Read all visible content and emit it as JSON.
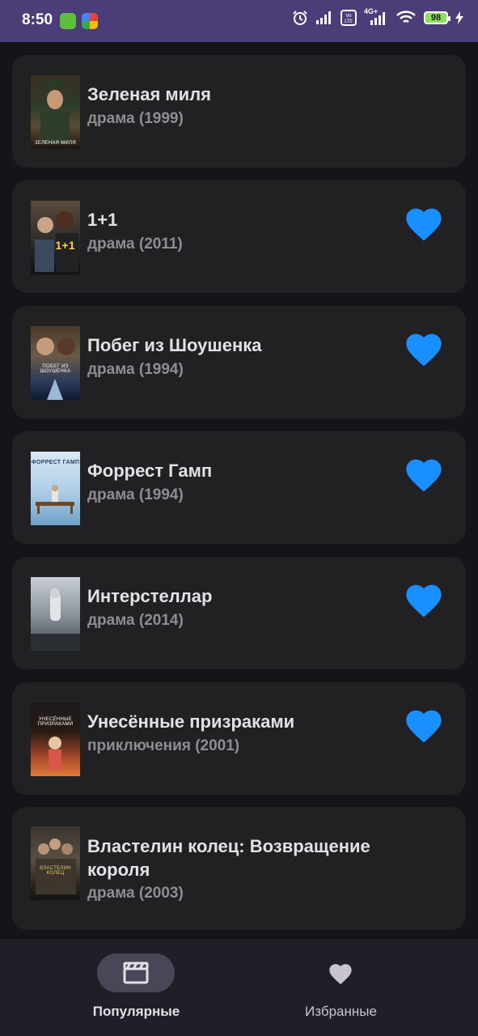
{
  "status_bar": {
    "time": "8:50",
    "battery": "98",
    "network": "4G+"
  },
  "movies": [
    {
      "title": "Зеленая миля",
      "subtitle": "драма (1999)",
      "favorite": false,
      "poster_caption": "ЗЕЛЕНАЯ МИЛЯ"
    },
    {
      "title": "1+1",
      "subtitle": "драма (2011)",
      "favorite": true,
      "poster_caption": "1+1"
    },
    {
      "title": "Побег из Шоушенка",
      "subtitle": "драма (1994)",
      "favorite": true,
      "poster_caption": "ПОБЕГ ИЗ ШОУШЕНКА"
    },
    {
      "title": "Форрест Гамп",
      "subtitle": "драма (1994)",
      "favorite": true,
      "poster_caption": "ФОРРЕСТ ГАМП"
    },
    {
      "title": "Интерстеллар",
      "subtitle": "драма (2014)",
      "favorite": true,
      "poster_caption": ""
    },
    {
      "title": "Унесённые призраками",
      "subtitle": "приключения (2001)",
      "favorite": true,
      "poster_caption": "УНЕСЁННЫЕ ПРИЗРАКАМИ"
    },
    {
      "title": "Властелин колец: Возвращение короля",
      "subtitle": "драма (2003)",
      "favorite": false,
      "poster_caption": "ВЛАСТЕЛИН КОЛЕЦ"
    }
  ],
  "bottom_nav": {
    "popular_label": "Популярные",
    "favorites_label": "Избранные",
    "active": "popular"
  },
  "colors": {
    "heart": "#1a8fff",
    "status_bar": "#4a3d78",
    "card": "#212023"
  }
}
